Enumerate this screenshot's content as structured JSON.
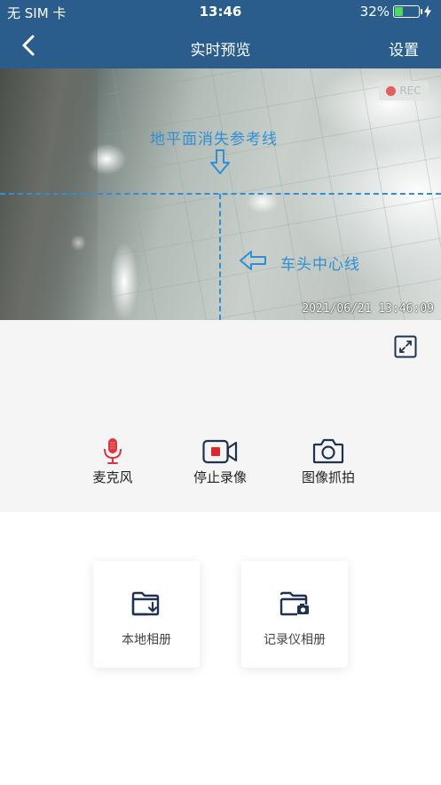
{
  "status_bar": {
    "carrier": "无 SIM 卡",
    "time": "13:46",
    "battery_percent": "32%",
    "battery_level": 0.32
  },
  "nav": {
    "title": "实时预览",
    "settings_label": "设置"
  },
  "video": {
    "rec_label": "REC",
    "horizon_label": "地平面消失参考线",
    "center_label": "车头中心线",
    "timestamp": "2021/06/21 13:46:09"
  },
  "controls": {
    "mic_label": "麦克风",
    "stop_record_label": "停止录像",
    "snapshot_label": "图像抓拍"
  },
  "albums": {
    "local_label": "本地相册",
    "recorder_label": "记录仪相册"
  },
  "colors": {
    "header_bg": "#2a5d8b",
    "guide_line": "#2f8fd2",
    "mic_red": "#d9363e",
    "icon_navy": "#1f3350",
    "battery_green": "#4cd964"
  }
}
